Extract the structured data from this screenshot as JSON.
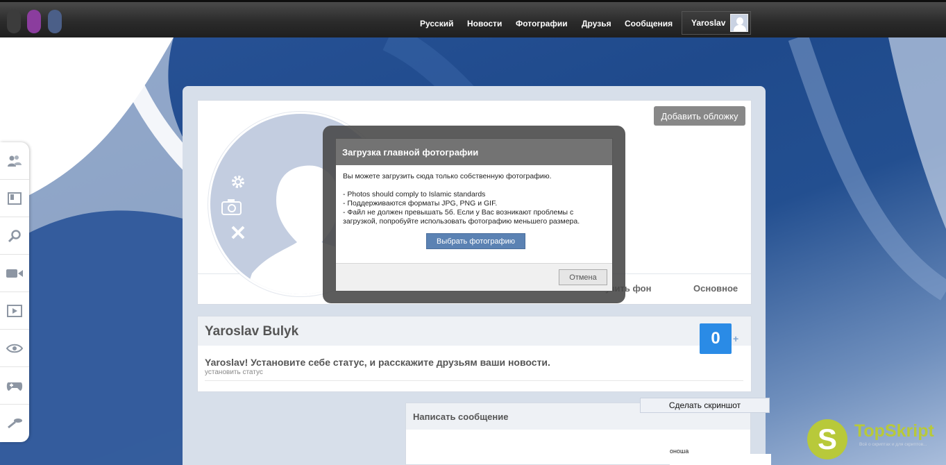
{
  "topbar": {
    "nav": [
      "Русский",
      "Новости",
      "Фотографии",
      "Друзья",
      "Сообщения"
    ],
    "user_name": "Yaroslav",
    "dot_colors": [
      "#3c3c3c",
      "#8b3d9e",
      "#4b5f88"
    ]
  },
  "sidebar": {
    "icons": [
      "friends-icon",
      "book-icon",
      "search-icon",
      "video-camera-icon",
      "play-icon",
      "eye-icon",
      "gamepad-icon",
      "ping-pong-icon"
    ]
  },
  "profile": {
    "add_cover_label": "Добавить обложку",
    "tabs": [
      "узить фон",
      "Основное"
    ],
    "avatar_icons": [
      "gear-icon",
      "camera-icon",
      "close-icon"
    ]
  },
  "dialog": {
    "title": "Загрузка главной фотографии",
    "intro": "Вы можете загрузить сюда только собственную фотографию.",
    "rules": [
      "- Photos should comply to Islamic standards",
      "- Поддерживаются форматы JPG, PNG и GIF.",
      "- Файл не должен превышать 5б. Если у Вас возникают проблемы с загрузкой, попробуйте использовать фотографию меньшего размера."
    ],
    "choose_label": "Выбрать фотографию",
    "cancel_label": "Отмена"
  },
  "name_card": {
    "name": "Yaroslav Bulyk",
    "counter": "0",
    "counter_plus": "+",
    "status_prompt": "Yaroslav! Установите себе статус, и расскажите друзьям ваши новости.",
    "status_link": "установить статус"
  },
  "message": {
    "title": "Написать сообщение"
  },
  "overlay": {
    "screenshot_label": "Сделать скриншот",
    "stray_text": "оноша"
  },
  "watermark": {
    "logo_letter": "S",
    "brand": "TopSkript",
    "tagline": "Всё о скриптах и для скриптов..."
  },
  "colors": {
    "accent_blue": "#2a8be6",
    "button_blue": "#5b82b3",
    "topbar": "#2b2b2b",
    "brand_green": "#b8c93a"
  }
}
